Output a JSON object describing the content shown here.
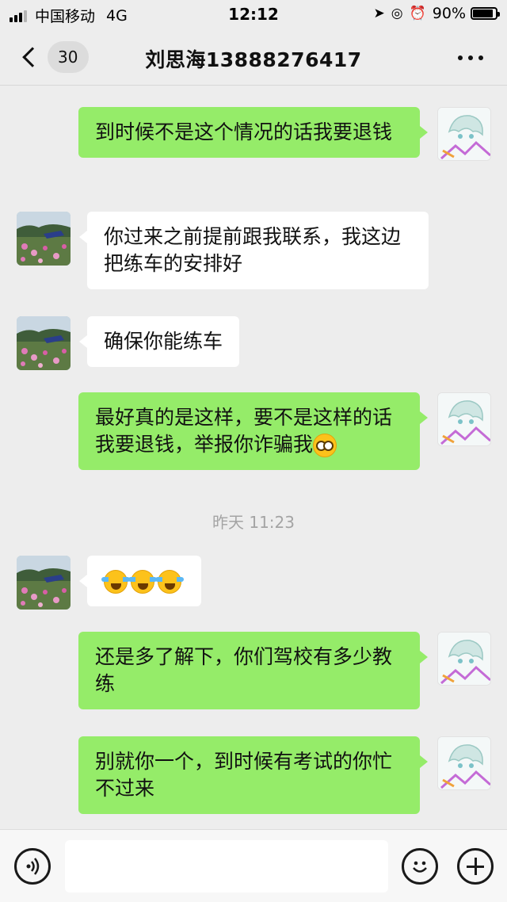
{
  "status_bar": {
    "carrier": "中国移动",
    "network": "4G",
    "time": "12:12",
    "battery": "90%",
    "battery_level": 0.9
  },
  "nav": {
    "unread_count": "30",
    "title": "刘思海13888276417"
  },
  "messages": [
    {
      "from": "me",
      "text": "到时候不是这个情况的话我要退钱"
    },
    {
      "from": "them",
      "text": "你过来之前提前跟我联系，我这边把练车的安排好"
    },
    {
      "from": "them",
      "text": "确保你能练车"
    },
    {
      "from": "me",
      "text": "最好真的是这样，要不是这样的话我要退钱，举报你诈骗我",
      "emoji": "flushed-face"
    },
    {
      "type": "time",
      "text": "昨天 11:23"
    },
    {
      "from": "them",
      "emojis": [
        "loudly-crying-face",
        "loudly-crying-face",
        "loudly-crying-face"
      ]
    },
    {
      "from": "me",
      "text": "还是多了解下，你们驾校有多少教练"
    },
    {
      "from": "me",
      "text": "别就你一个，到时候有考试的你忙不过来"
    }
  ],
  "input": {
    "value": "",
    "icons": [
      "voice-icon",
      "emoji-icon",
      "add-icon"
    ]
  },
  "colors": {
    "my_bubble": "#95ec69",
    "their_bubble": "#ffffff",
    "background": "#ededed"
  }
}
